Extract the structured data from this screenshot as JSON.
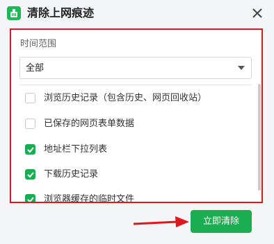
{
  "window": {
    "title": "清除上网痕迹",
    "app_icon": "green-broom-icon",
    "close_icon": "close-icon"
  },
  "time_range": {
    "label": "时间范围",
    "selected": "全部"
  },
  "options": [
    {
      "label": "浏览历史记录（包含历史、网页回收站）",
      "checked": false
    },
    {
      "label": "已保存的网页表单数据",
      "checked": false
    },
    {
      "label": "地址栏下拉列表",
      "checked": true
    },
    {
      "label": "下载历史记录",
      "checked": true
    },
    {
      "label": "浏览器缓存的临时文件",
      "checked": true
    }
  ],
  "actions": {
    "clear_now": "立即清除"
  },
  "colors": {
    "accent": "#1aad51",
    "highlight_border": "#e0161e",
    "arrow": "#e0161e"
  }
}
